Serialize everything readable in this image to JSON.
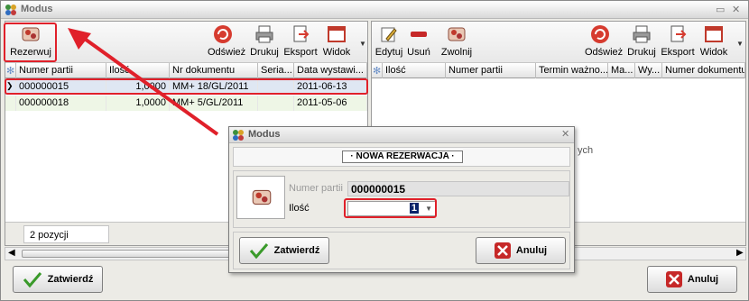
{
  "window": {
    "title": "Modus",
    "controls": [
      "▭",
      "✕"
    ]
  },
  "left_toolbar": {
    "reserve_label": "Rezerwuj",
    "refresh_label": "Odśwież",
    "print_label": "Drukuj",
    "export_label": "Eksport",
    "view_label": "Widok"
  },
  "right_toolbar": {
    "edit_label": "Edytuj",
    "delete_label": "Usuń",
    "release_label": "Zwolnij",
    "refresh_label": "Odśwież",
    "print_label": "Drukuj",
    "export_label": "Eksport",
    "view_label": "Widok"
  },
  "left_grid": {
    "headers": [
      "Numer partii",
      "Ilość",
      "Nr dokumentu",
      "Seria...",
      "Data wystawi..."
    ],
    "rows": [
      [
        "000000015",
        "1,0000",
        "MM+ 18/GL/2011",
        "",
        "2011-06-13"
      ],
      [
        "000000018",
        "1,0000",
        "MM+ 5/GL/2011",
        "",
        "2011-05-06"
      ]
    ]
  },
  "right_grid": {
    "headers": [
      "Ilość",
      "Numer partii",
      "Termin ważno...",
      "Ma...",
      "Wy...",
      "Numer dokumentu"
    ],
    "empty_text": "ych"
  },
  "left_status": {
    "count": "2 pozycji"
  },
  "main_buttons": {
    "confirm_label": "Zatwierdź",
    "cancel_label": "Anuluj"
  },
  "dialog": {
    "title": "Modus",
    "heading": "· NOWA REZERWACJA ·",
    "batch_label": "Numer partii",
    "batch_value": "000000015",
    "qty_label": "Ilość",
    "qty_value": "1",
    "confirm_label": "Zatwierdź",
    "cancel_label": "Anuluj"
  },
  "colors": {
    "highlight_red": "#e0202a",
    "selected_row": "#dfe7f3",
    "alt_row": "#eef6e6"
  }
}
